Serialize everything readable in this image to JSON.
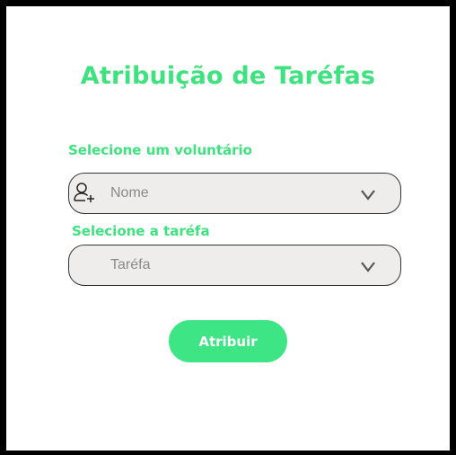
{
  "page": {
    "title": "Atribuição de Taréfas"
  },
  "volunteer": {
    "label": "Selecione um voluntário",
    "value": "Nome",
    "icon": "user-add-icon"
  },
  "task": {
    "label": "Selecione a taréfa",
    "value": "Taréfa"
  },
  "actions": {
    "assign_label": "Atribuir"
  },
  "colors": {
    "accent": "#3ee27f",
    "field_bg": "#efedeb",
    "placeholder": "#8a8a8a"
  }
}
